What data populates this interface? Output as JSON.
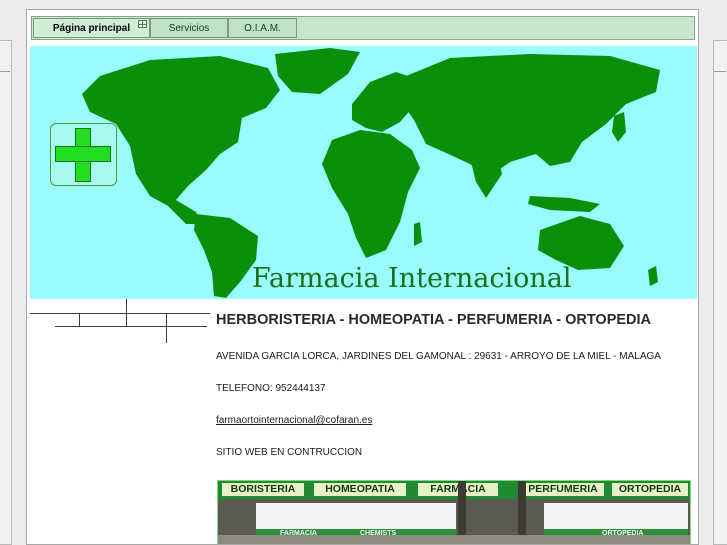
{
  "nav": {
    "items": [
      {
        "label": "Página principal"
      },
      {
        "label": "Servicios"
      },
      {
        "label": "O.I.A.M."
      }
    ]
  },
  "banner": {
    "title": "Farmacia Internacional"
  },
  "content": {
    "heading": "HERBORISTERIA - HOMEOPATIA - PERFUMERIA - ORTOPEDIA",
    "address": "AVENIDA GARCIA LORCA, JARDINES DEL GAMONAL : 29631 - ARROYO DE LA MIEL - MALAGA",
    "phone": "TELEFONO: 952444137",
    "email": "farmaortointernacional@cofaran.es",
    "status": "SITIO WEB EN CONTRUCCION"
  },
  "photo": {
    "signs": [
      "BORISTERIA",
      "HOMEOPATIA",
      "FARMACIA",
      "PERFUMERIA",
      "ORTOPEDIA"
    ],
    "small_signs": [
      "FARMACIA",
      "CHEMISTS",
      "ORTOPEDIA"
    ]
  },
  "colors": {
    "banner_bg": "#99fbfb",
    "continents": "#0a8f0a",
    "nav_bg": "#c7e6cd",
    "cross": "#22dd22"
  },
  "icons": [
    "plus-cross-icon",
    "world-map",
    "nav-grid-icon"
  ]
}
